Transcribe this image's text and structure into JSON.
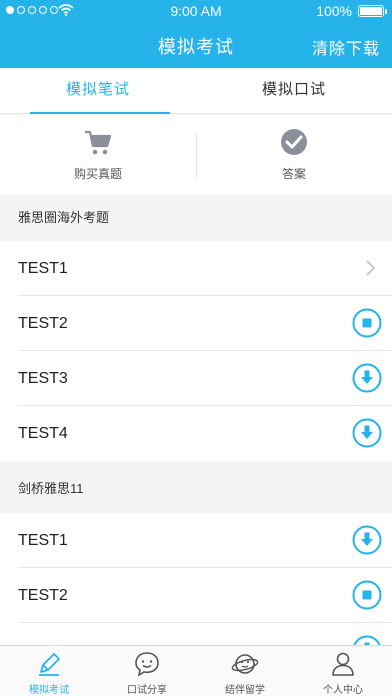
{
  "status_bar": {
    "time": "9:00 AM",
    "battery": "100%"
  },
  "nav": {
    "title": "模拟考试",
    "action": "清除下载"
  },
  "tabs": [
    {
      "label": "模拟笔试",
      "active": true
    },
    {
      "label": "模拟口试",
      "active": false
    }
  ],
  "quick_actions": [
    {
      "label": "购买真题",
      "icon": "cart-icon"
    },
    {
      "label": "答案",
      "icon": "check-badge-icon"
    }
  ],
  "sections": [
    {
      "title": "雅思圈海外考题",
      "items": [
        {
          "label": "TEST1",
          "state": "chevron"
        },
        {
          "label": "TEST2",
          "state": "stop"
        },
        {
          "label": "TEST3",
          "state": "download"
        },
        {
          "label": "TEST4",
          "state": "download"
        }
      ]
    },
    {
      "title": "剑桥雅思11",
      "items": [
        {
          "label": "TEST1",
          "state": "download"
        },
        {
          "label": "TEST2",
          "state": "stop"
        },
        {
          "label": "",
          "state": "download"
        }
      ]
    }
  ],
  "tabbar": [
    {
      "label": "模拟考试",
      "icon": "pencil-icon",
      "active": true
    },
    {
      "label": "口试分享",
      "icon": "chat-face-icon",
      "active": false
    },
    {
      "label": "结伴留学",
      "icon": "planet-face-icon",
      "active": false
    },
    {
      "label": "个人中心",
      "icon": "person-icon",
      "active": false
    }
  ],
  "colors": {
    "accent": "#25b3ea",
    "background": "#f4f4f4",
    "icon_gray": "#8a8f99"
  }
}
